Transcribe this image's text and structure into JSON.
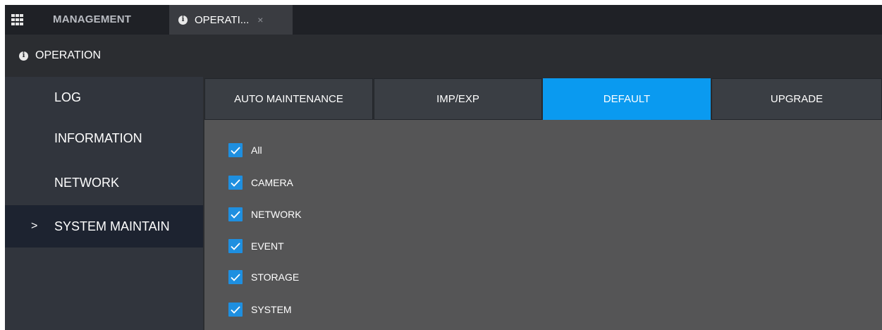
{
  "topbar": {
    "apps_icon": "grid-icon",
    "management_label": "MANAGEMENT",
    "active_tab_label": "OPERATI...",
    "close_label": "×"
  },
  "header": {
    "title": "OPERATION"
  },
  "sidebar": {
    "items": [
      {
        "label": "LOG"
      },
      {
        "label": "INFORMATION"
      },
      {
        "label": "NETWORK"
      },
      {
        "label": "SYSTEM MAINTAIN",
        "chevron": ">"
      }
    ]
  },
  "tabs": [
    {
      "label": "AUTO MAINTENANCE"
    },
    {
      "label": "IMP/EXP"
    },
    {
      "label": "DEFAULT"
    },
    {
      "label": "UPGRADE"
    }
  ],
  "options": [
    {
      "label": "All",
      "checked": true
    },
    {
      "label": "CAMERA",
      "checked": true
    },
    {
      "label": "NETWORK",
      "checked": true
    },
    {
      "label": "EVENT",
      "checked": true
    },
    {
      "label": "STORAGE",
      "checked": true
    },
    {
      "label": "SYSTEM",
      "checked": true
    }
  ],
  "colors": {
    "accent": "#0a9af0",
    "checkbox": "#1e8fe0",
    "active_sidebar": "#1d2330"
  }
}
